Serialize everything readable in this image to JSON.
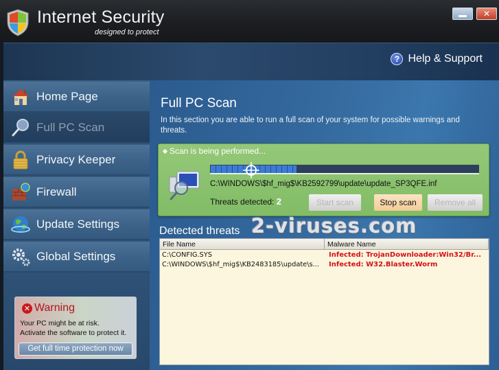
{
  "window": {
    "title": "Internet Security",
    "subtitle": "designed to protect",
    "minimize_icon": "minimize-icon",
    "close_icon": "close-icon",
    "close_glyph": "✕"
  },
  "header": {
    "help_label": "Help & Support",
    "help_icon": "question-icon",
    "help_glyph": "?"
  },
  "sidebar": {
    "items": [
      {
        "label": "Home Page",
        "icon": "house-icon",
        "active": false
      },
      {
        "label": "Full PC Scan",
        "icon": "magnifier-icon",
        "active": true
      },
      {
        "label": "Privacy Keeper",
        "icon": "padlock-icon",
        "active": false
      },
      {
        "label": "Firewall",
        "icon": "brick-wall-globe-icon",
        "active": false
      },
      {
        "label": "Update Settings",
        "icon": "globe-icon",
        "active": false
      },
      {
        "label": "Global Settings",
        "icon": "gears-icon",
        "active": false
      }
    ]
  },
  "warning": {
    "title": "Warning",
    "icon_glyph": "✕",
    "line1": "Your PC might be at risk.",
    "line2": "Activate the software to protect it.",
    "button_label": "Get full time protection now"
  },
  "main": {
    "title": "Full PC Scan",
    "description": "In this section you are able to run a full scan of your system for possible warnings and threats.",
    "scan": {
      "status": "Scan is being performed...",
      "progress_fraction": 0.32,
      "current_file": "C:\\WINDOWS\\$hf_mig$\\KB2592799\\update\\update_SP3QFE.inf",
      "threats_label": "Threats detected:",
      "threats_count": "2",
      "buttons": {
        "start": "Start scan",
        "stop": "Stop scan",
        "remove": "Remove all"
      }
    },
    "watermark": "2-viruses.com",
    "detected_label": "Detected threats",
    "table": {
      "columns": [
        "File Name",
        "Malware Name"
      ],
      "rows": [
        [
          "C:\\CONFIG.SYS",
          "Infected: TrojanDownloader:Win32/Br..."
        ],
        [
          "C:\\WINDOWS\\$hf_mig$\\KB2483185\\update\\s...",
          "Infected: W32.Blaster.Worm"
        ]
      ]
    }
  },
  "colors": {
    "accent_green": "#8ac26e",
    "threat_red": "#d4101a",
    "warning_red": "#b0151a"
  }
}
